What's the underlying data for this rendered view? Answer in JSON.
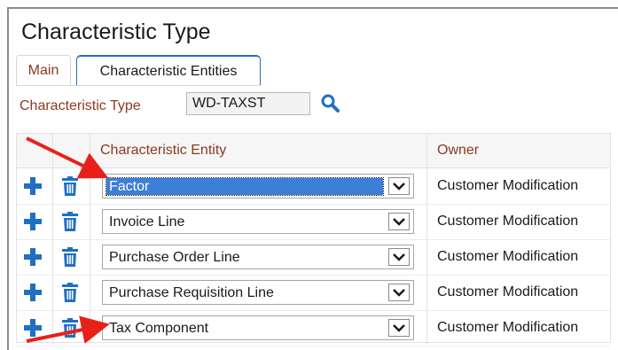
{
  "page": {
    "title": "Characteristic Type"
  },
  "tabs": [
    {
      "label": "Main",
      "active": false
    },
    {
      "label": "Characteristic Entities",
      "active": true
    }
  ],
  "field": {
    "label": "Characteristic Type",
    "value": "WD-TAXST"
  },
  "grid": {
    "columns": [
      "Characteristic Entity",
      "Owner"
    ],
    "rows": [
      {
        "entity": "Factor",
        "owner": "Customer Modification",
        "selected": true
      },
      {
        "entity": "Invoice Line",
        "owner": "Customer Modification"
      },
      {
        "entity": "Purchase Order Line",
        "owner": "Customer Modification"
      },
      {
        "entity": "Purchase Requisition Line",
        "owner": "Customer Modification"
      },
      {
        "entity": "Tax Component",
        "owner": "Customer Modification"
      }
    ]
  },
  "icons": {
    "add": "plus-icon",
    "delete": "trash-icon",
    "search": "magnifier-icon",
    "dropdown": "chevron-down-icon",
    "annotation": "red-arrow-icon"
  },
  "colors": {
    "accent": "#1f6fc4",
    "label": "#8a3a1f",
    "annotation": "#e8201a",
    "selection": "#3b7fd6"
  }
}
